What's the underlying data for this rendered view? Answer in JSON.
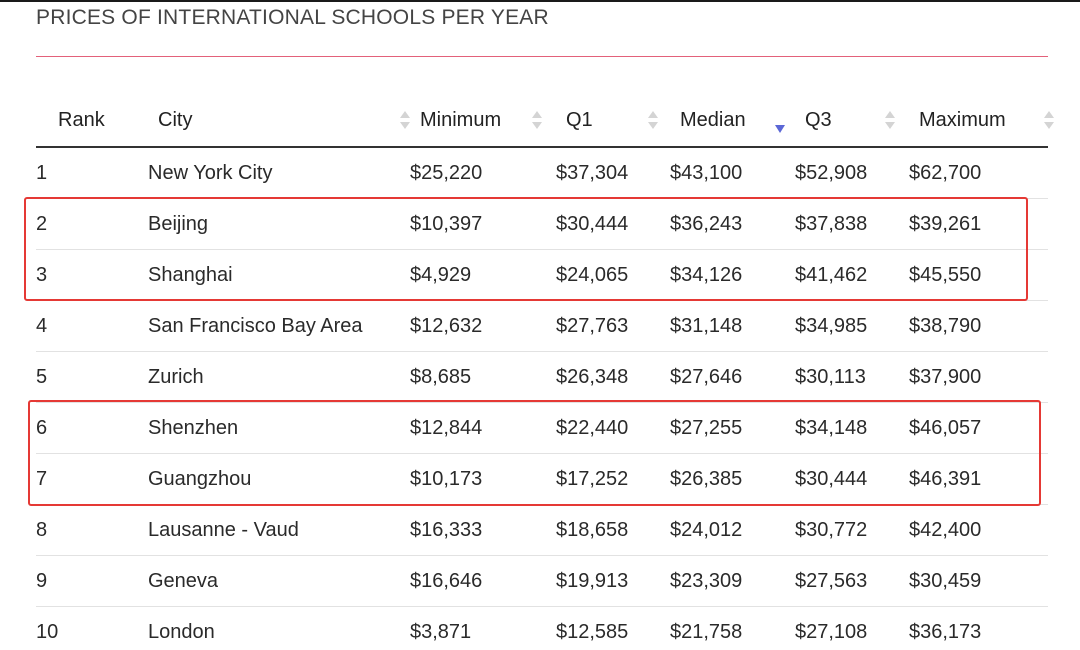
{
  "title": "PRICES OF INTERNATIONAL SCHOOLS PER YEAR",
  "table": {
    "columns": [
      {
        "key": "rank",
        "label": "Rank",
        "sortable": false
      },
      {
        "key": "city",
        "label": "City",
        "sortable": true,
        "sort": "none"
      },
      {
        "key": "minimum",
        "label": "Minimum",
        "sortable": true,
        "sort": "none"
      },
      {
        "key": "q1",
        "label": "Q1",
        "sortable": true,
        "sort": "none"
      },
      {
        "key": "median",
        "label": "Median",
        "sortable": true,
        "sort": "desc"
      },
      {
        "key": "q3",
        "label": "Q3",
        "sortable": true,
        "sort": "none"
      },
      {
        "key": "maximum",
        "label": "Maximum",
        "sortable": true,
        "sort": "none"
      }
    ],
    "rows": [
      {
        "rank": "1",
        "city": "New York City",
        "minimum": "$25,220",
        "q1": "$37,304",
        "median": "$43,100",
        "q3": "$52,908",
        "maximum": "$62,700"
      },
      {
        "rank": "2",
        "city": "Beijing",
        "minimum": "$10,397",
        "q1": "$30,444",
        "median": "$36,243",
        "q3": "$37,838",
        "maximum": "$39,261"
      },
      {
        "rank": "3",
        "city": "Shanghai",
        "minimum": "$4,929",
        "q1": "$24,065",
        "median": "$34,126",
        "q3": "$41,462",
        "maximum": "$45,550"
      },
      {
        "rank": "4",
        "city": "San Francisco Bay Area",
        "minimum": "$12,632",
        "q1": "$27,763",
        "median": "$31,148",
        "q3": "$34,985",
        "maximum": "$38,790"
      },
      {
        "rank": "5",
        "city": "Zurich",
        "minimum": "$8,685",
        "q1": "$26,348",
        "median": "$27,646",
        "q3": "$30,113",
        "maximum": "$37,900"
      },
      {
        "rank": "6",
        "city": "Shenzhen",
        "minimum": "$12,844",
        "q1": "$22,440",
        "median": "$27,255",
        "q3": "$34,148",
        "maximum": "$46,057"
      },
      {
        "rank": "7",
        "city": "Guangzhou",
        "minimum": "$10,173",
        "q1": "$17,252",
        "median": "$26,385",
        "q3": "$30,444",
        "maximum": "$46,391"
      },
      {
        "rank": "8",
        "city": "Lausanne - Vaud",
        "minimum": "$16,333",
        "q1": "$18,658",
        "median": "$24,012",
        "q3": "$30,772",
        "maximum": "$42,400"
      },
      {
        "rank": "9",
        "city": "Geneva",
        "minimum": "$16,646",
        "q1": "$19,913",
        "median": "$23,309",
        "q3": "$27,563",
        "maximum": "$30,459"
      },
      {
        "rank": "10",
        "city": "London",
        "minimum": "$3,871",
        "q1": "$12,585",
        "median": "$21,758",
        "q3": "$27,108",
        "maximum": "$36,173"
      }
    ]
  },
  "highlights": {
    "color": "#e53935",
    "groups": [
      [
        "2",
        "3"
      ],
      [
        "6",
        "7"
      ]
    ]
  },
  "colors": {
    "title_rule": "#e3617a",
    "sort_active": "#5b67d6",
    "sort_inactive": "#d4d4d4"
  }
}
